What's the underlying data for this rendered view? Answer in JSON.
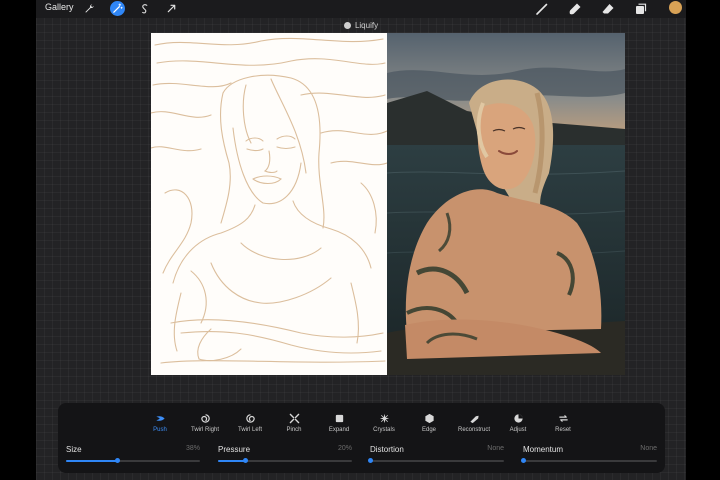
{
  "topbar": {
    "gallery_label": "Gallery",
    "left_tools": [
      "wrench-icon",
      "magic-wand-icon",
      "selection-icon",
      "transform-arrow-icon"
    ],
    "active_tool": "magic-wand-icon",
    "right_tools": [
      "brush-icon",
      "smudge-icon",
      "eraser-icon",
      "layers-icon"
    ],
    "current_color": "#d8a256"
  },
  "mode": {
    "title": "Liquify"
  },
  "canvas": {
    "left_panel": "line sketch",
    "right_panel": "reference photo"
  },
  "liquify_panel": {
    "tools": [
      {
        "label": "Push",
        "icon": "push-icon"
      },
      {
        "label": "Twirl Right",
        "icon": "twirl-right-icon"
      },
      {
        "label": "Twirl Left",
        "icon": "twirl-left-icon"
      },
      {
        "label": "Pinch",
        "icon": "pinch-icon"
      },
      {
        "label": "Expand",
        "icon": "expand-icon"
      },
      {
        "label": "Crystals",
        "icon": "crystals-icon"
      },
      {
        "label": "Edge",
        "icon": "edge-icon"
      },
      {
        "label": "Reconstruct",
        "icon": "reconstruct-icon"
      },
      {
        "label": "Adjust",
        "icon": "adjust-icon"
      },
      {
        "label": "Reset",
        "icon": "reset-icon"
      }
    ],
    "active_tool": "Push",
    "sliders": [
      {
        "name": "Size",
        "value_text": "38%",
        "level": 0.38
      },
      {
        "name": "Pressure",
        "value_text": "20%",
        "level": 0.2
      },
      {
        "name": "Distortion",
        "value_text": "None",
        "level": 0
      },
      {
        "name": "Momentum",
        "value_text": "None",
        "level": 0
      }
    ]
  },
  "colors": {
    "accent": "#2f86f6",
    "panel": "#141416",
    "background": "#232325"
  }
}
